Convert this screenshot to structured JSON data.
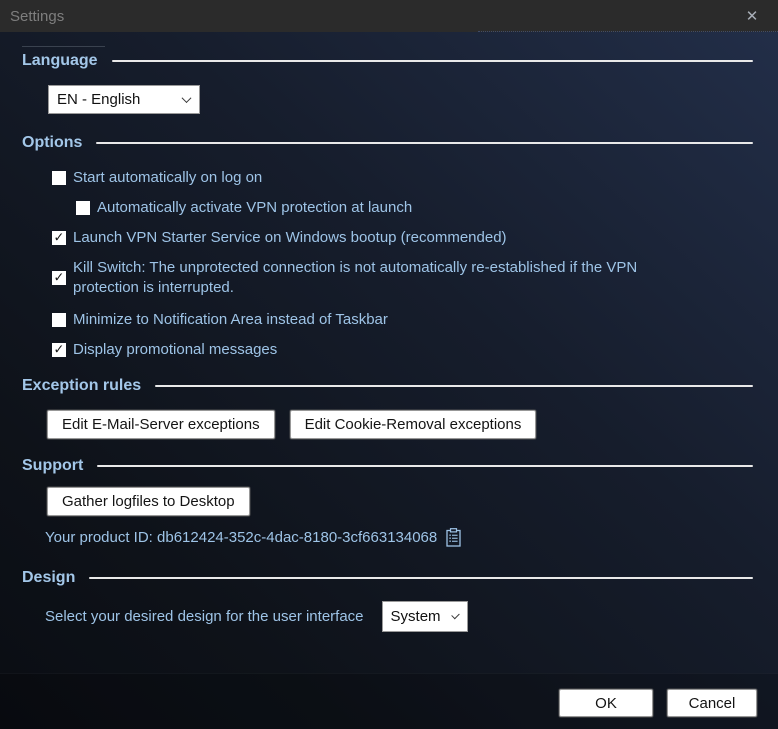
{
  "window": {
    "title": "Settings"
  },
  "glyphs": {
    "check": "✓",
    "close": "✕"
  },
  "colors": {
    "titlebar_bg": "#2b2b2b",
    "content_bg_top_right": "#222e48",
    "content_bg_bottom_left": "#0a0d13",
    "accent_text": "#9ec4e7",
    "heading_text": "#a3c7e9",
    "rule": "#e9e9e9",
    "button_bg": "#ffffff",
    "button_text": "#141414"
  },
  "language": {
    "heading": "Language",
    "dropdown_value": "EN - English"
  },
  "options": {
    "heading": "Options",
    "items": [
      {
        "label": "Start automatically on log on",
        "checked": false,
        "indent": 0,
        "multiline": false
      },
      {
        "label": "Automatically activate VPN protection at launch",
        "checked": false,
        "indent": 1,
        "multiline": false
      },
      {
        "label": "Launch VPN Starter Service on Windows bootup (recommended)",
        "checked": true,
        "indent": 0,
        "multiline": false
      },
      {
        "label": "Kill Switch: The unprotected connection is not automatically re-established if the VPN protection is interrupted.",
        "checked": true,
        "indent": 0,
        "multiline": true
      },
      {
        "label": "Minimize to Notification Area instead of Taskbar",
        "checked": false,
        "indent": 0,
        "multiline": false
      },
      {
        "label": "Display promotional messages",
        "checked": true,
        "indent": 0,
        "multiline": false
      }
    ]
  },
  "exception_rules": {
    "heading": "Exception rules",
    "buttons": [
      "Edit E-Mail-Server exceptions",
      "Edit Cookie-Removal exceptions"
    ]
  },
  "support": {
    "heading": "Support",
    "button": "Gather logfiles to Desktop",
    "product_id_text": "Your product ID: db612424-352c-4dac-8180-3cf663134068"
  },
  "design": {
    "heading": "Design",
    "label": "Select your desired design for the user interface",
    "dropdown_value": "System"
  },
  "footer": {
    "ok": "OK",
    "cancel": "Cancel"
  }
}
